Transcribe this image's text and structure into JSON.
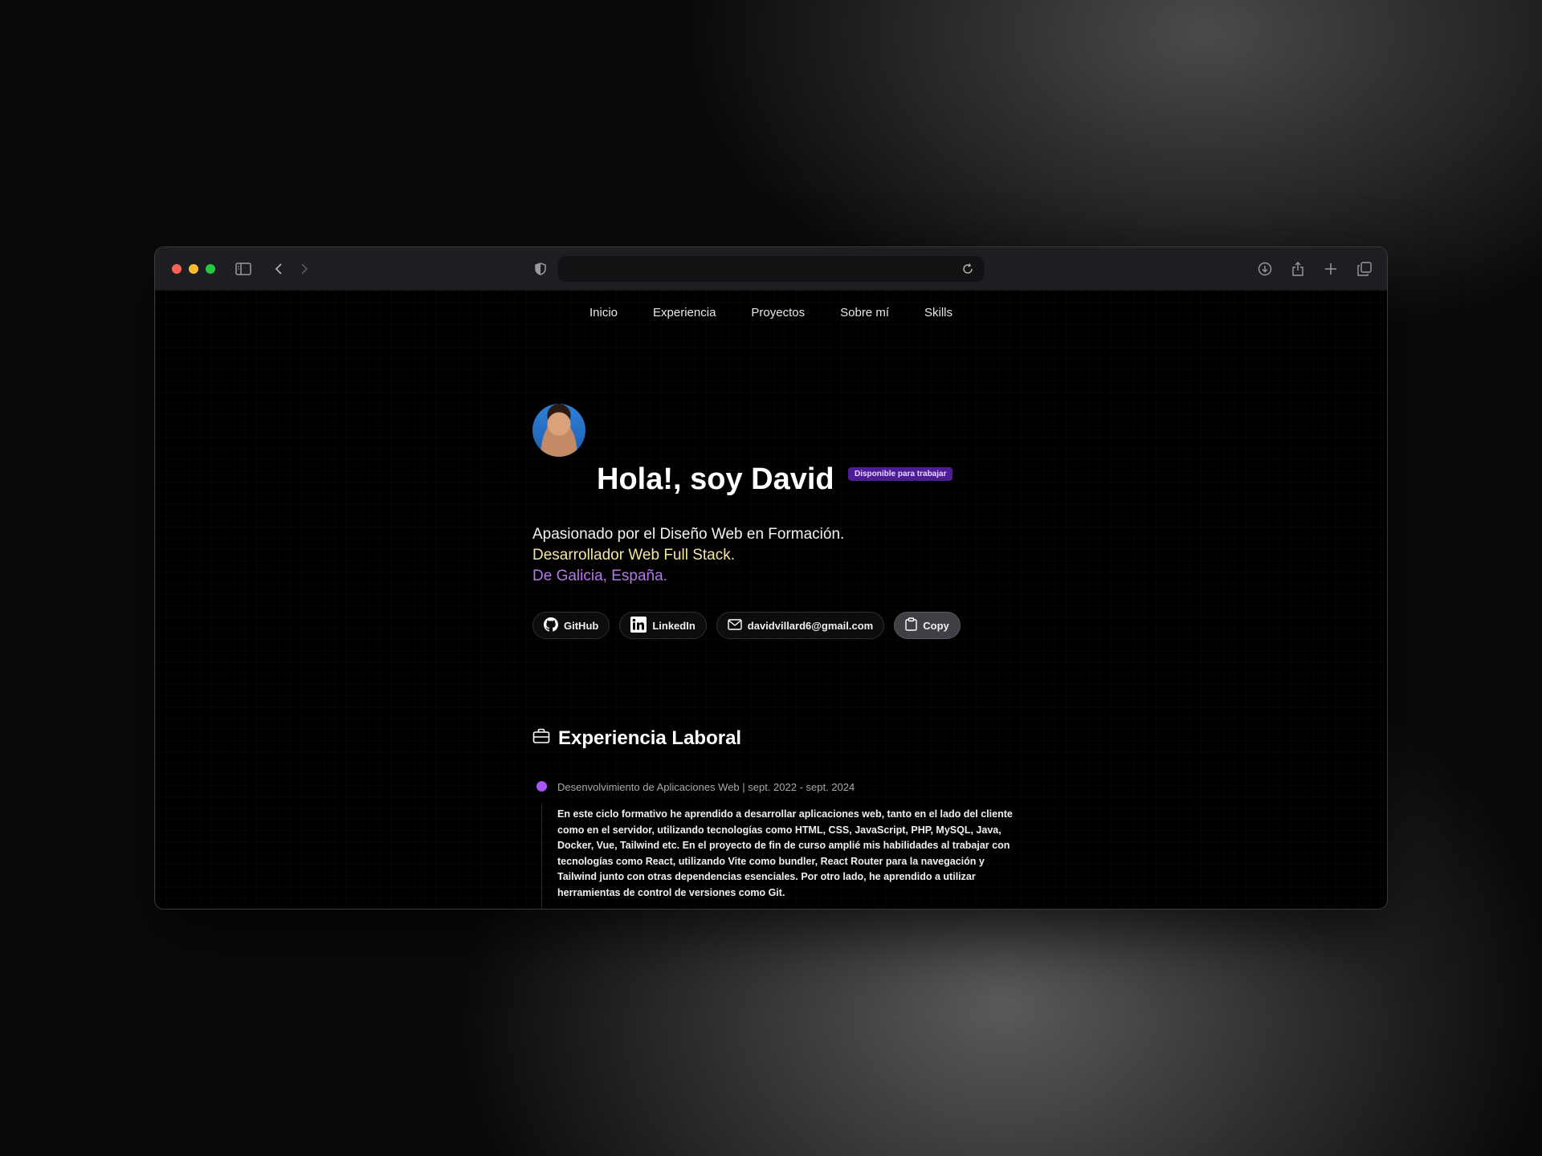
{
  "nav": [
    "Inicio",
    "Experiencia",
    "Proyectos",
    "Sobre mí",
    "Skills"
  ],
  "hero": {
    "title": "Hola!, soy David",
    "badge": "Disponible para trabajar",
    "line1": "Apasionado por el Diseño Web en Formación.",
    "line2": "Desarrollador Web Full Stack.",
    "line3": "De Galicia, España."
  },
  "links": {
    "github": "GitHub",
    "linkedin": "LinkedIn",
    "email": "davidvillard6@gmail.com",
    "copy": "Copy"
  },
  "experience": {
    "heading": "Experiencia Laboral",
    "job_title": "Desenvolvimiento de Aplicaciones Web | sept. 2022 - sept. 2024",
    "job_desc": "En este ciclo formativo he aprendido a desarrollar aplicaciones web, tanto en el lado del cliente como en el servidor, utilizando tecnologías como HTML, CSS, JavaScript, PHP, MySQL, Java, Docker, Vue, Tailwind etc. En el proyecto de fin de curso amplié mis habilidades al trabajar con tecnologías como React, utilizando Vite como bundler, React Router para la navegación y Tailwind junto con otras dependencias esenciales. Por otro lado, he aprendido a utilizar herramientas de control de versiones como Git."
  },
  "colors": {
    "close": "#ff5f57",
    "minimize": "#febc2e",
    "maximize": "#28c840",
    "badge": "#4c1d95",
    "accent_yellow": "#f3e6a6",
    "accent_purple": "#b478e8",
    "timeline_dot": "#a855f7"
  },
  "icons": [
    "sidebar-icon",
    "back-icon",
    "forward-icon",
    "shield-icon",
    "reload-icon",
    "download-icon",
    "share-icon",
    "new-tab-icon",
    "tabs-icon",
    "github-icon",
    "linkedin-icon",
    "mail-icon",
    "clipboard-icon",
    "briefcase-icon"
  ]
}
